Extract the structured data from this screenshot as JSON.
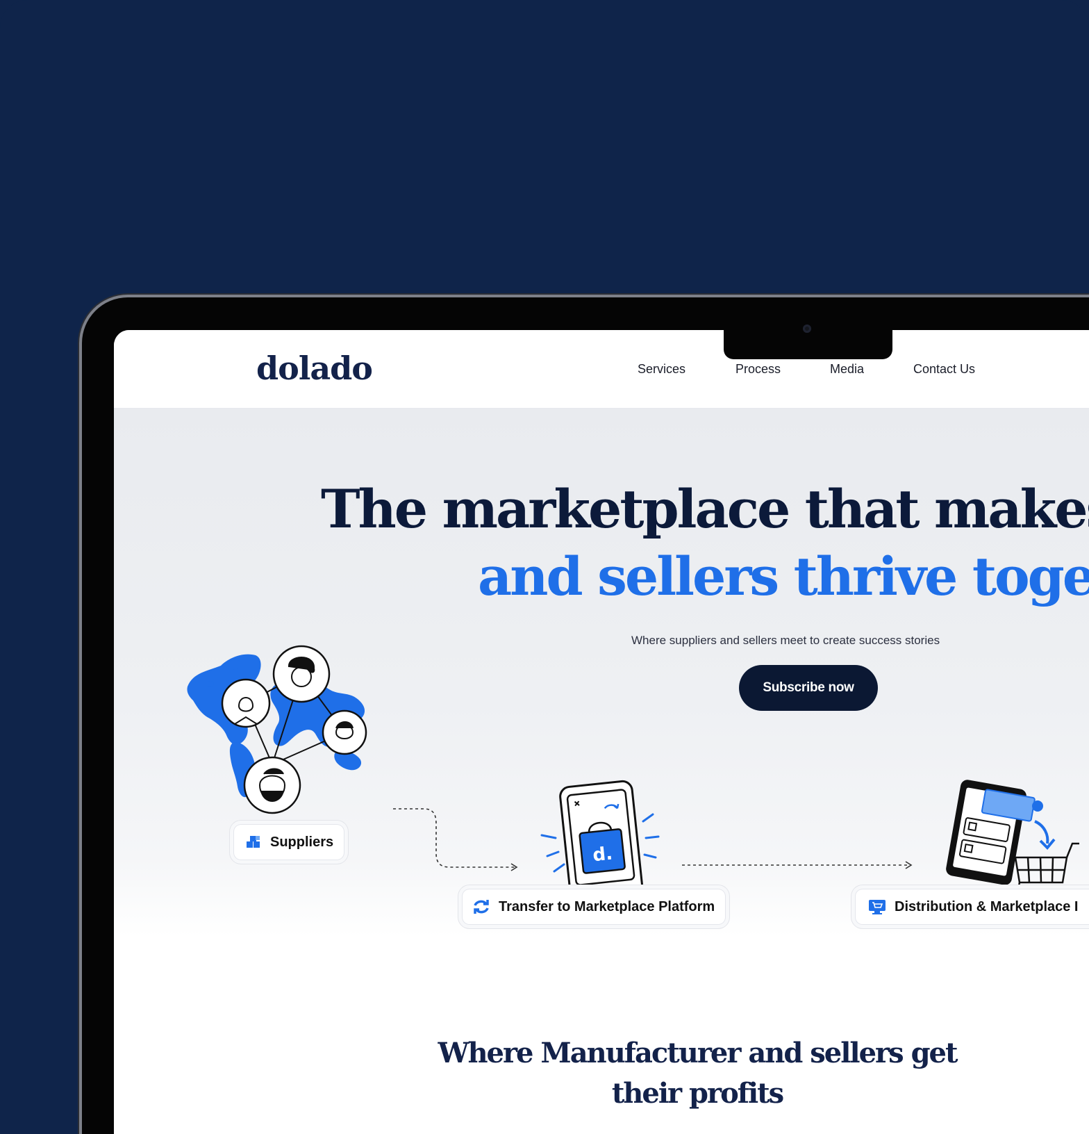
{
  "brand": {
    "logo": "dolado"
  },
  "nav": {
    "items": [
      {
        "label": "Services"
      },
      {
        "label": "Process"
      },
      {
        "label": "Media"
      },
      {
        "label": "Contact Us"
      }
    ]
  },
  "hero": {
    "headline_line1": "The marketplace that makes ",
    "headline_line1_highlight": "s",
    "headline_line2": "and sellers thrive togeth",
    "subtitle": "Where suppliers and sellers meet to create success stories",
    "cta_label": "Subscribe now"
  },
  "flow": {
    "suppliers": {
      "label": "Suppliers",
      "icon": "boxes-icon"
    },
    "transfer": {
      "label": "Transfer to Marketplace Platform",
      "icon": "sync-icon"
    },
    "distribution": {
      "label": "Distribution & Marketplace I",
      "icon": "monitor-cart-icon"
    }
  },
  "section": {
    "heading": "Where Manufacturer and sellers get their profits"
  },
  "colors": {
    "background": "#0f244a",
    "navy": "#0b1833",
    "accent_blue": "#1f6fe8"
  }
}
